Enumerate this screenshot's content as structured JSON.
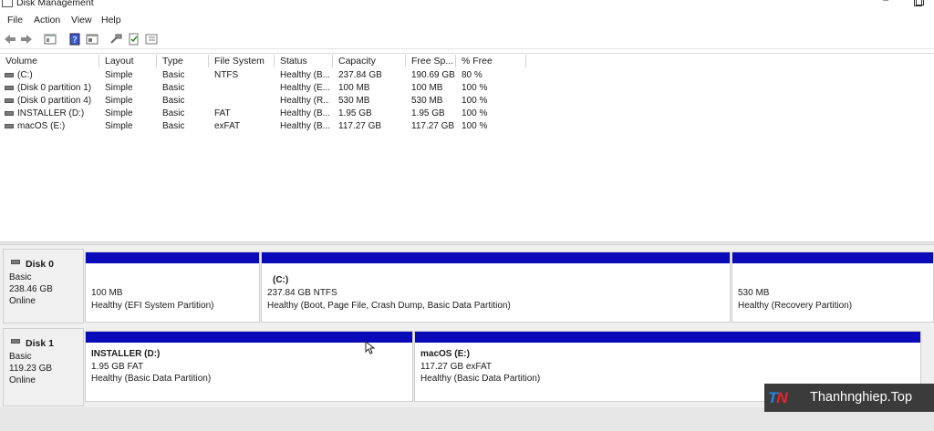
{
  "window": {
    "title": "Disk Management"
  },
  "menu": [
    "File",
    "Action",
    "View",
    "Help"
  ],
  "toolbar": {
    "icons": [
      "back-icon",
      "forward-icon",
      "properties-icon",
      "help-icon",
      "show-pane-icon",
      "connect-icon",
      "check-icon",
      "list-icon"
    ]
  },
  "volume_table": {
    "headers": [
      "Volume",
      "Layout",
      "Type",
      "File System",
      "Status",
      "Capacity",
      "Free Sp...",
      "% Free"
    ],
    "rows": [
      [
        "(C:)",
        "Simple",
        "Basic",
        "NTFS",
        "Healthy (B...",
        "237.84 GB",
        "190.69 GB",
        "80 %"
      ],
      [
        "(Disk 0 partition 1)",
        "Simple",
        "Basic",
        "",
        "Healthy (E...",
        "100 MB",
        "100 MB",
        "100 %"
      ],
      [
        "(Disk 0 partition 4)",
        "Simple",
        "Basic",
        "",
        "Healthy (R...",
        "530 MB",
        "530 MB",
        "100 %"
      ],
      [
        "INSTALLER (D:)",
        "Simple",
        "Basic",
        "FAT",
        "Healthy (B...",
        "1.95 GB",
        "1.95 GB",
        "100 %"
      ],
      [
        "macOS (E:)",
        "Simple",
        "Basic",
        "exFAT",
        "Healthy (B...",
        "117.27 GB",
        "117.27 GB",
        "100 %"
      ]
    ]
  },
  "disks": [
    {
      "name": "Disk 0",
      "type": "Basic",
      "size": "238.46 GB",
      "status": "Online",
      "partitions": [
        {
          "label": "",
          "size_fs": "100 MB",
          "status": "Healthy (EFI System Partition)"
        },
        {
          "label": "(C:)",
          "size_fs": "237.84 GB NTFS",
          "status": "Healthy (Boot, Page File, Crash Dump, Basic Data Partition)"
        },
        {
          "label": "",
          "size_fs": "530 MB",
          "status": "Healthy (Recovery Partition)"
        }
      ]
    },
    {
      "name": "Disk 1",
      "type": "Basic",
      "size": "119.23 GB",
      "status": "Online",
      "partitions": [
        {
          "label": "INSTALLER  (D:)",
          "size_fs": "1.95 GB FAT",
          "status": "Healthy (Basic Data Partition)"
        },
        {
          "label": "macOS  (E:)",
          "size_fs": "117.27 GB exFAT",
          "status": "Healthy (Basic Data Partition)"
        }
      ]
    }
  ],
  "watermark": {
    "logo": "TN",
    "text": "Thanhnghiep.Top"
  },
  "colors": {
    "partition_bar": "#0a0ab8",
    "logo_red": "#e8262a",
    "logo_blue": "#1e88e5"
  }
}
